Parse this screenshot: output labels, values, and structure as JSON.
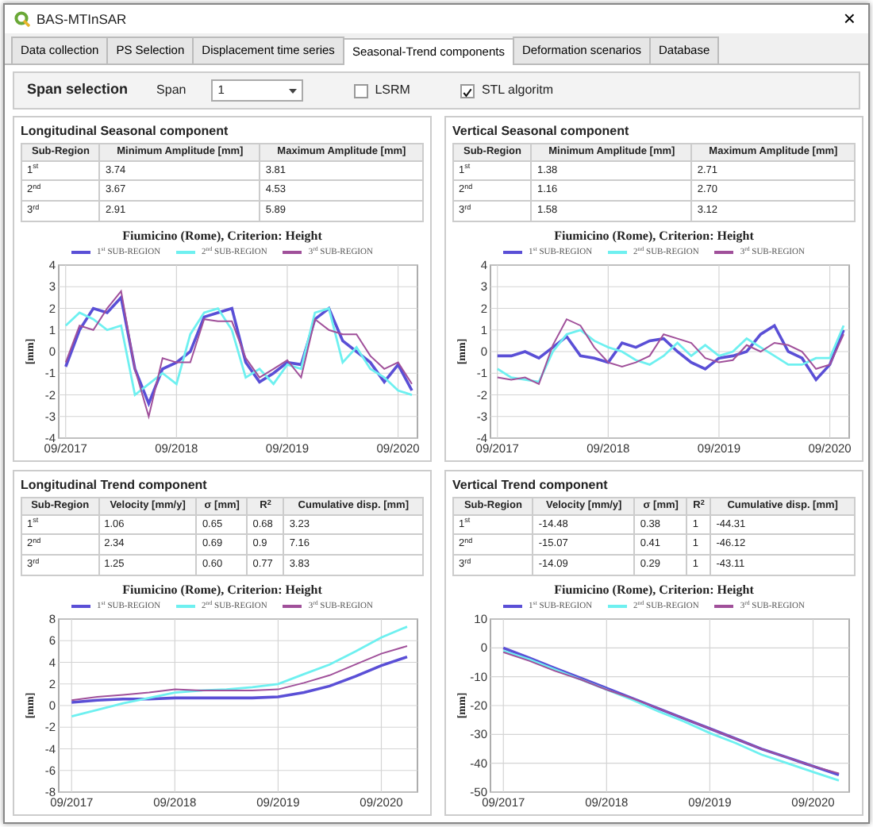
{
  "window": {
    "title": "BAS-MTInSAR",
    "close": "×"
  },
  "tabs": [
    {
      "label": "Data collection",
      "selected": false
    },
    {
      "label": "PS Selection",
      "selected": false
    },
    {
      "label": "Displacement time series",
      "selected": false
    },
    {
      "label": "Seasonal-Trend components",
      "selected": true
    },
    {
      "label": "Deformation scenarios",
      "selected": false
    },
    {
      "label": "Database",
      "selected": false
    }
  ],
  "span_selection": {
    "title": "Span selection",
    "span_label": "Span",
    "span_value": "1",
    "options": [
      {
        "label": "LSRM",
        "checked": false
      },
      {
        "label": "STL algoritm",
        "checked": true
      }
    ]
  },
  "panels": [
    {
      "title": "Longitudinal Seasonal component",
      "table": {
        "columns": [
          "Sub-Region",
          "Minimum Amplitude [mm]",
          "Maximum Amplitude [mm]"
        ],
        "rows": [
          [
            "1$^{st}$",
            "3.74",
            "3.81"
          ],
          [
            "2$^{nd}$",
            "3.67",
            "4.53"
          ],
          [
            "3$^{rd}$",
            "2.91",
            "5.89"
          ]
        ]
      },
      "chart_data": {
        "type": "line",
        "title": "Fiumicino (Rome), Criterion: Height",
        "ylabel": "[mm]",
        "grid": true,
        "legend": true,
        "categories": [
          "09/2017",
          null,
          null,
          null,
          null,
          null,
          null,
          null,
          "09/2018",
          null,
          null,
          null,
          null,
          null,
          null,
          null,
          "09/2019",
          null,
          null,
          null,
          null,
          null,
          null,
          null,
          "09/2020",
          null
        ],
        "ylim": [
          -4,
          4
        ],
        "yticks": [
          -4,
          -3,
          -2,
          -1,
          0,
          1,
          2,
          3,
          4
        ],
        "series": [
          {
            "name": "1$^{st}$ SUB-REGION",
            "color": "#5a4fd6",
            "values": [
              -0.7,
              1.0,
              2.0,
              1.8,
              2.5,
              -0.8,
              -2.4,
              -0.8,
              -0.5,
              0.0,
              1.6,
              1.8,
              2.0,
              -0.5,
              -1.4,
              -1.0,
              -0.5,
              -0.6,
              1.5,
              2.0,
              0.5,
              0.0,
              -0.5,
              -1.4,
              -0.6,
              -1.8
            ]
          },
          {
            "name": "2$^{nd}$ SUB-REGION",
            "color": "#6ef0f0",
            "values": [
              1.2,
              1.8,
              1.5,
              1.0,
              1.2,
              -2.0,
              -1.5,
              -1.0,
              -1.5,
              0.8,
              1.8,
              2.0,
              1.0,
              -1.2,
              -0.8,
              -1.5,
              -0.6,
              -0.8,
              1.8,
              2.0,
              -0.5,
              0.2,
              -0.8,
              -1.2,
              -1.8,
              -2.0
            ]
          },
          {
            "name": "3$^{rd}$ SUB-REGION",
            "color": "#a0509a",
            "values": [
              -0.5,
              1.2,
              1.0,
              2.0,
              2.8,
              -0.8,
              -3.0,
              -0.3,
              -0.5,
              -0.5,
              1.5,
              1.4,
              1.4,
              -0.3,
              -1.2,
              -0.8,
              -0.4,
              -1.2,
              1.5,
              1.0,
              0.8,
              0.8,
              -0.2,
              -0.8,
              -0.5,
              -1.5
            ]
          }
        ]
      }
    },
    {
      "title": "Vertical Seasonal component",
      "table": {
        "columns": [
          "Sub-Region",
          "Minimum Amplitude [mm]",
          "Maximum Amplitude [mm]"
        ],
        "rows": [
          [
            "1$^{st}$",
            "1.38",
            "2.71"
          ],
          [
            "2$^{nd}$",
            "1.16",
            "2.70"
          ],
          [
            "3$^{rd}$",
            "1.58",
            "3.12"
          ]
        ]
      },
      "chart_data": {
        "type": "line",
        "title": "Fiumicino (Rome), Criterion: Height",
        "ylabel": "[mm]",
        "grid": true,
        "legend": true,
        "categories": [
          "09/2017",
          null,
          null,
          null,
          null,
          null,
          null,
          null,
          "09/2018",
          null,
          null,
          null,
          null,
          null,
          null,
          null,
          "09/2019",
          null,
          null,
          null,
          null,
          null,
          null,
          null,
          "09/2020",
          null
        ],
        "ylim": [
          -4,
          4
        ],
        "yticks": [
          -4,
          -3,
          -2,
          -1,
          0,
          1,
          2,
          3,
          4
        ],
        "series": [
          {
            "name": "1$^{st}$ SUB-REGION",
            "color": "#5a4fd6",
            "values": [
              -0.2,
              -0.2,
              0.0,
              -0.3,
              0.2,
              0.7,
              -0.2,
              -0.3,
              -0.5,
              0.4,
              0.2,
              0.5,
              0.6,
              0.0,
              -0.5,
              -0.8,
              -0.3,
              -0.2,
              0.0,
              0.8,
              1.2,
              0.0,
              -0.3,
              -1.3,
              -0.6,
              1.0
            ]
          },
          {
            "name": "2$^{nd}$ SUB-REGION",
            "color": "#6ef0f0",
            "values": [
              -0.8,
              -1.2,
              -1.3,
              -1.4,
              0.0,
              0.8,
              1.0,
              0.5,
              0.2,
              0.0,
              -0.4,
              -0.6,
              -0.2,
              0.4,
              -0.2,
              0.3,
              -0.2,
              0.0,
              0.6,
              0.2,
              -0.2,
              -0.6,
              -0.6,
              -0.3,
              -0.3,
              1.2
            ]
          },
          {
            "name": "3$^{rd}$ SUB-REGION",
            "color": "#a0509a",
            "values": [
              -1.2,
              -1.3,
              -1.2,
              -1.5,
              0.3,
              1.5,
              1.2,
              0.2,
              -0.5,
              -0.7,
              -0.5,
              -0.2,
              0.8,
              0.6,
              0.4,
              -0.3,
              -0.5,
              -0.4,
              0.3,
              0.0,
              0.4,
              0.3,
              0.0,
              -0.8,
              -0.6,
              0.8
            ]
          }
        ]
      }
    },
    {
      "title": "Longitudinal Trend component",
      "table": {
        "columns": [
          "Sub-Region",
          "Velocity [mm/y]",
          "σ [mm]",
          "R$^{2}$",
          "Cumulative disp. [mm]"
        ],
        "rows": [
          [
            "1$^{st}$",
            "1.06",
            "0.65",
            "0.68",
            "3.23"
          ],
          [
            "2$^{nd}$",
            "2.34",
            "0.69",
            "0.9",
            "7.16"
          ],
          [
            "3$^{rd}$",
            "1.25",
            "0.60",
            "0.77",
            "3.83"
          ]
        ]
      },
      "chart_data": {
        "type": "line",
        "title": "Fiumicino (Rome), Criterion: Height",
        "ylabel": "[mm]",
        "grid": true,
        "legend": true,
        "categories": [
          "09/2017",
          null,
          null,
          null,
          "09/2018",
          null,
          null,
          null,
          "09/2019",
          null,
          null,
          null,
          "09/2020",
          null
        ],
        "ylim": [
          -8,
          8
        ],
        "yticks": [
          -8,
          -6,
          -4,
          -2,
          0,
          2,
          4,
          6,
          8
        ],
        "series": [
          {
            "name": "1$^{st}$ SUB-REGION",
            "color": "#5a4fd6",
            "values": [
              0.3,
              0.5,
              0.6,
              0.6,
              0.7,
              0.7,
              0.7,
              0.7,
              0.8,
              1.2,
              1.8,
              2.7,
              3.7,
              4.5
            ]
          },
          {
            "name": "2$^{nd}$ SUB-REGION",
            "color": "#6ef0f0",
            "values": [
              -1.0,
              -0.4,
              0.2,
              0.7,
              1.2,
              1.4,
              1.5,
              1.7,
              2.0,
              2.9,
              3.8,
              5.0,
              6.3,
              7.3
            ]
          },
          {
            "name": "3$^{rd}$ SUB-REGION",
            "color": "#a0509a",
            "values": [
              0.5,
              0.8,
              1.0,
              1.2,
              1.5,
              1.4,
              1.4,
              1.4,
              1.5,
              2.1,
              2.8,
              3.8,
              4.8,
              5.5
            ]
          }
        ]
      }
    },
    {
      "title": "Vertical Trend component",
      "table": {
        "columns": [
          "Sub-Region",
          "Velocity [mm/y]",
          "σ [mm]",
          "R$^{2}$",
          "Cumulative disp. [mm]"
        ],
        "rows": [
          [
            "1$^{st}$",
            "-14.48",
            "0.38",
            "1",
            "-44.31"
          ],
          [
            "2$^{nd}$",
            "-15.07",
            "0.41",
            "1",
            "-46.12"
          ],
          [
            "3$^{rd}$",
            "-14.09",
            "0.29",
            "1",
            "-43.11"
          ]
        ]
      },
      "chart_data": {
        "type": "line",
        "title": "Fiumicino (Rome), Criterion: Height",
        "ylabel": "[mm]",
        "grid": true,
        "legend": true,
        "categories": [
          "09/2017",
          null,
          null,
          null,
          "09/2018",
          null,
          null,
          null,
          "09/2019",
          null,
          null,
          null,
          "09/2020",
          null
        ],
        "ylim": [
          -50,
          10
        ],
        "yticks": [
          -50,
          -40,
          -30,
          -20,
          -10,
          0,
          10
        ],
        "series": [
          {
            "name": "1$^{st}$ SUB-REGION",
            "color": "#5a4fd6",
            "values": [
              0,
              -3.5,
              -7,
              -10.5,
              -14,
              -17.5,
              -21,
              -24.5,
              -28,
              -31.5,
              -35,
              -38,
              -41,
              -44
            ]
          },
          {
            "name": "2$^{nd}$ SUB-REGION",
            "color": "#6ef0f0",
            "values": [
              -1,
              -4,
              -7.5,
              -11,
              -14.5,
              -18,
              -22,
              -25.5,
              -29.5,
              -33,
              -37,
              -40,
              -43,
              -46
            ]
          },
          {
            "name": "3$^{rd}$ SUB-REGION",
            "color": "#a0509a",
            "values": [
              -1.5,
              -4.5,
              -8,
              -11,
              -14.5,
              -17.5,
              -21,
              -24.5,
              -28,
              -31.5,
              -35,
              -38,
              -41,
              -43.5
            ]
          }
        ]
      }
    }
  ]
}
